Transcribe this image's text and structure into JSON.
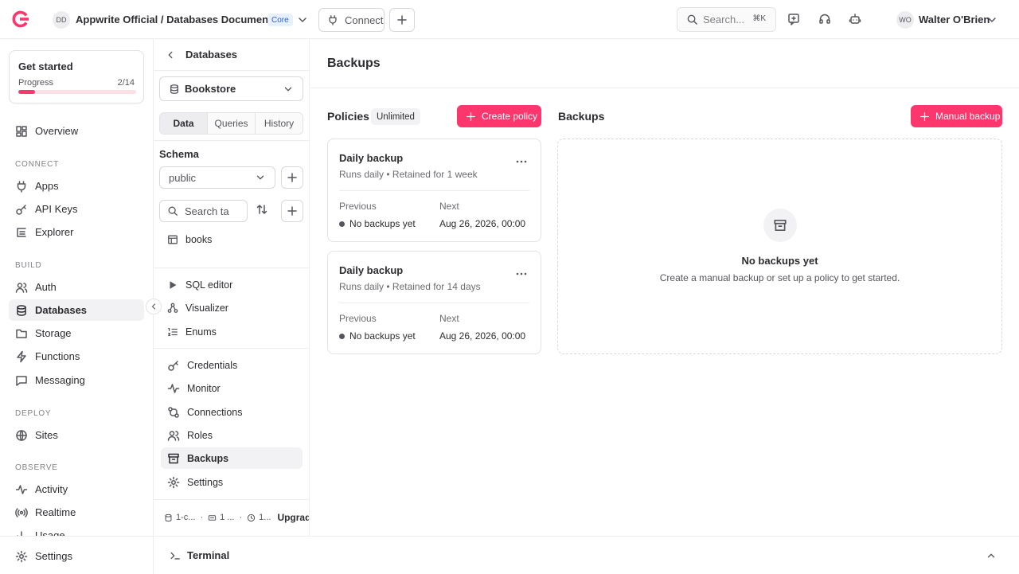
{
  "topbar": {
    "project_initials": "DD",
    "breadcrumb": "Appwrite Official / Databases Documention",
    "plan_badge": "Core",
    "connect_label": "Connect",
    "search_placeholder": "Search...",
    "search_shortcut": "⌘K",
    "user_initials": "WO",
    "user_name": "Walter O'Brien"
  },
  "sidebar": {
    "get_started": {
      "title": "Get started",
      "progress_label": "Progress",
      "progress_text": "2/14",
      "progress_fraction": 0.143
    },
    "overview": "Overview",
    "sections": {
      "connect": "CONNECT",
      "build": "BUILD",
      "deploy": "DEPLOY",
      "observe": "OBSERVE"
    },
    "items": {
      "apps": "Apps",
      "api_keys": "API Keys",
      "explorer": "Explorer",
      "auth": "Auth",
      "databases": "Databases",
      "storage": "Storage",
      "functions": "Functions",
      "messaging": "Messaging",
      "sites": "Sites",
      "activity": "Activity",
      "realtime": "Realtime",
      "usage": "Usage"
    },
    "settings": "Settings"
  },
  "panel": {
    "back_label": "Databases",
    "database": "Bookstore",
    "tabs": [
      "Data",
      "Queries",
      "History"
    ],
    "schema_label": "Schema",
    "schema_value": "public",
    "search_placeholder": "Search ta",
    "tables": [
      "books"
    ],
    "tools": [
      "SQL editor",
      "Visualizer",
      "Enums"
    ],
    "settings_items": [
      "Credentials",
      "Monitor",
      "Connections",
      "Roles",
      "Backups",
      "Settings"
    ],
    "footer": {
      "item1": "1-c...",
      "item2": "1 ...",
      "item3": "1...",
      "upgrade": "Upgrade"
    }
  },
  "main": {
    "title": "Backups",
    "policies_title": "Policies",
    "policies_badge": "Unlimited",
    "create_policy": "Create policy",
    "backups_title": "Backups",
    "manual_backup": "Manual backup",
    "policies": [
      {
        "title": "Daily backup",
        "schedule": "Runs daily",
        "retention": "Retained for 1 week",
        "previous_label": "Previous",
        "previous_value": "No backups yet",
        "next_label": "Next",
        "next_value": "Aug 26, 2026, 00:00"
      },
      {
        "title": "Daily backup",
        "schedule": "Runs daily",
        "retention": "Retained for 14 days",
        "previous_label": "Previous",
        "previous_value": "No backups yet",
        "next_label": "Next",
        "next_value": "Aug 26, 2026, 00:00"
      }
    ],
    "empty": {
      "title": "No backups yet",
      "subtitle": "Create a manual backup or set up a policy to get started."
    }
  },
  "terminal": {
    "label": "Terminal"
  },
  "colors": {
    "brand": "#fd366e",
    "core_badge": "#2b5fd9"
  }
}
